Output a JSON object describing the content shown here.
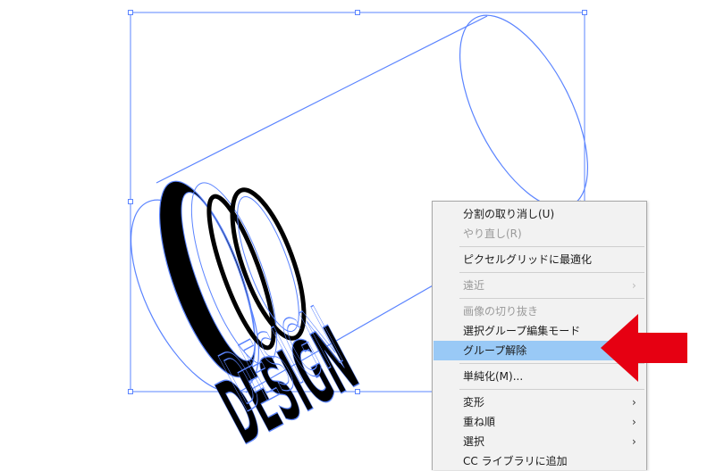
{
  "context_menu": {
    "items": [
      {
        "label": "分割の取り消し(U)",
        "enabled": true,
        "submenu": false
      },
      {
        "label": "やり直し(R)",
        "enabled": false,
        "submenu": false
      },
      {
        "label": "ピクセルグリッドに最適化",
        "enabled": true,
        "submenu": false
      },
      {
        "label": "遠近",
        "enabled": false,
        "submenu": true,
        "chevron": "›"
      },
      {
        "label": "画像の切り抜き",
        "enabled": false,
        "submenu": false
      },
      {
        "label": "選択グループ編集モード",
        "enabled": true,
        "submenu": false
      },
      {
        "label": "グループ解除",
        "enabled": true,
        "submenu": false,
        "highlighted": true
      },
      {
        "label": "単純化(M)...",
        "enabled": true,
        "submenu": false
      },
      {
        "label": "変形",
        "enabled": true,
        "submenu": true,
        "chevron": "›"
      },
      {
        "label": "重ね順",
        "enabled": true,
        "submenu": true,
        "chevron": "›"
      },
      {
        "label": "選択",
        "enabled": true,
        "submenu": true,
        "chevron": "›"
      },
      {
        "label": "CC ライブラリに追加",
        "enabled": true,
        "submenu": false
      }
    ]
  },
  "artwork": {
    "selection_color": "#5b84ff",
    "text_fill": "#000000",
    "arrow_color": "#e60012",
    "highlight_color": "#99c9f6"
  }
}
